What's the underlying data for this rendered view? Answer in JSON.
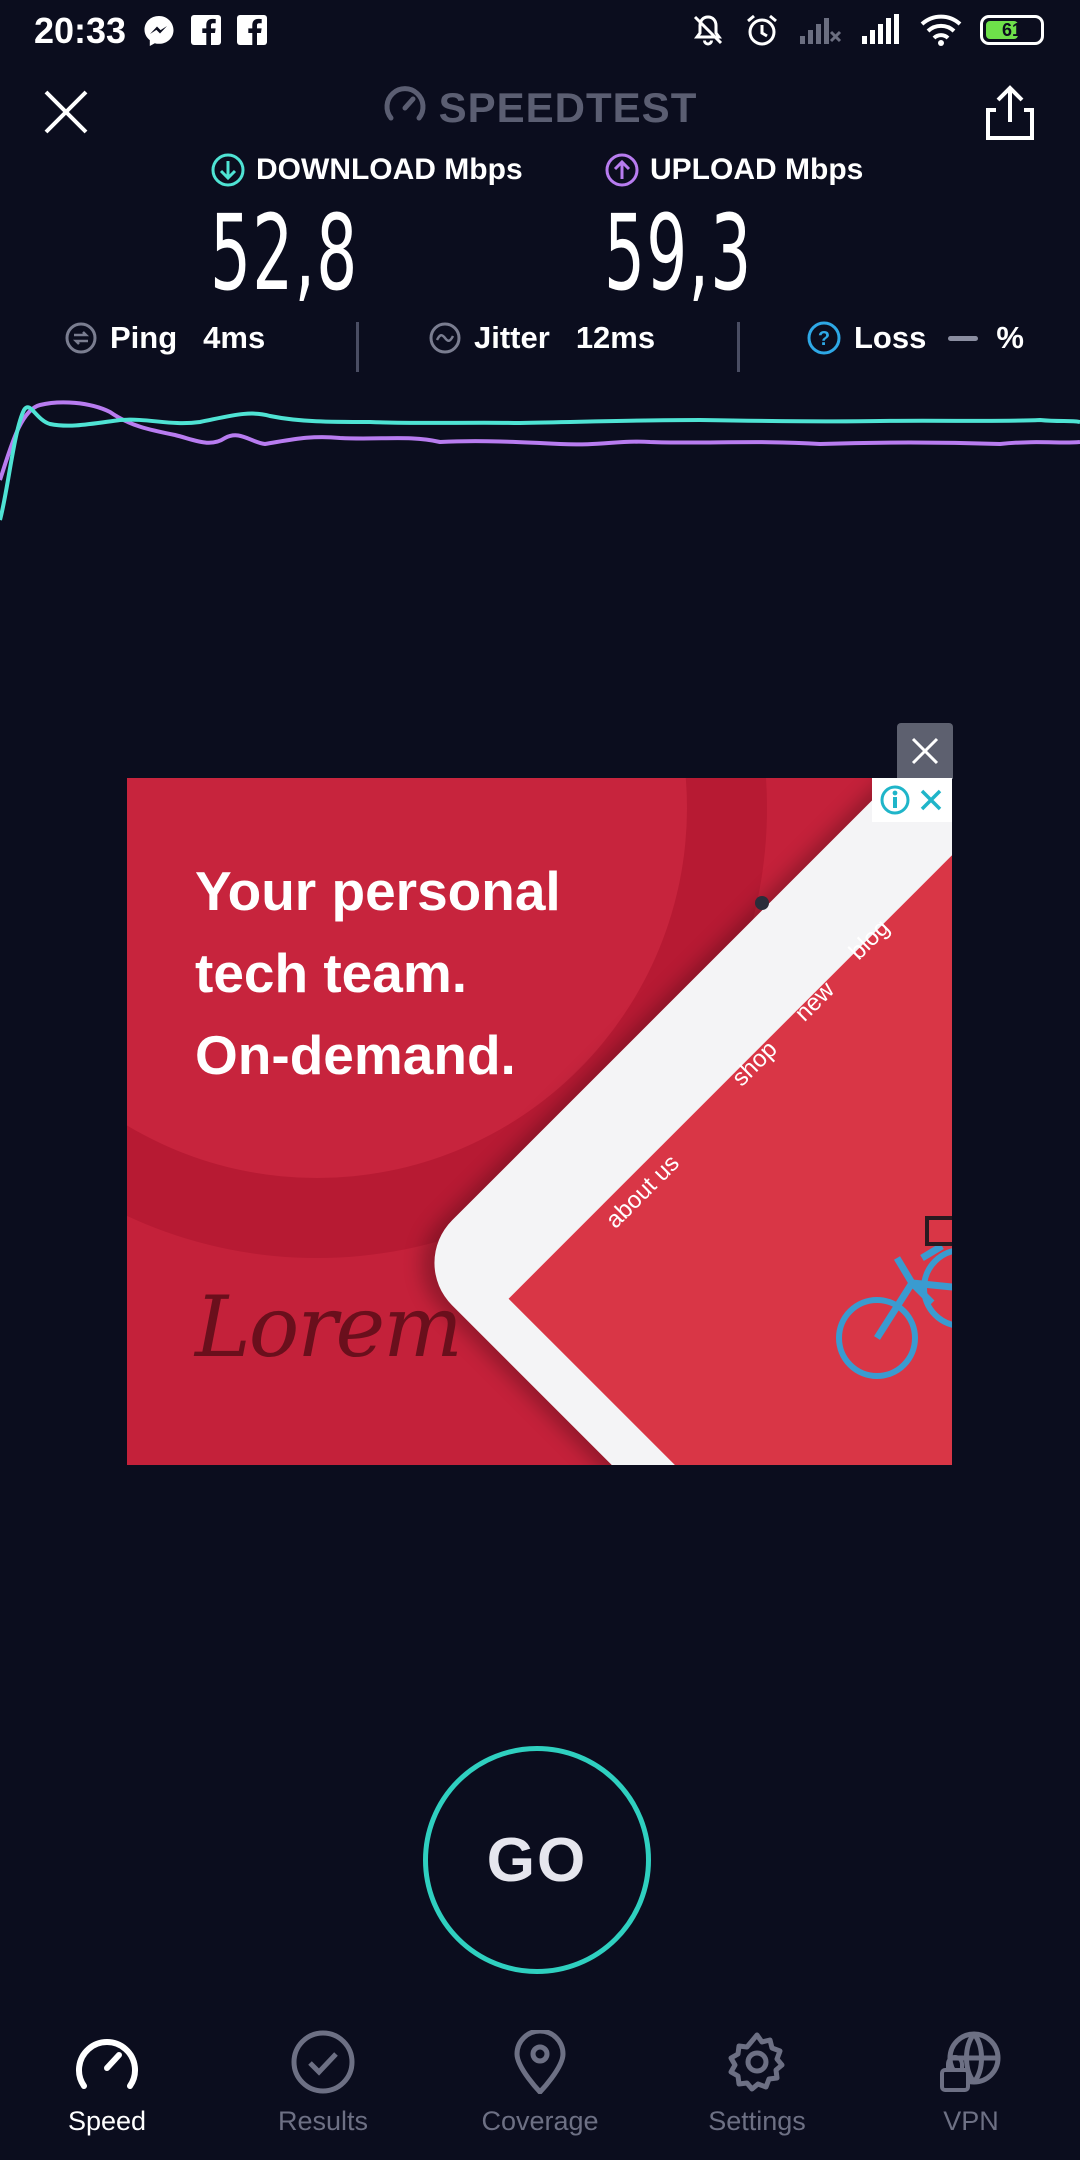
{
  "status_bar": {
    "time": "20:33",
    "battery": "61",
    "battery_level": 0.61,
    "left_icons": [
      "messenger-icon",
      "facebook-icon",
      "facebook-icon"
    ],
    "right_icons": [
      "notifications-off-icon",
      "alarm-icon",
      "signal-off-icon",
      "signal-icon",
      "wifi-icon",
      "battery-icon"
    ]
  },
  "header": {
    "title": "SPEEDTEST",
    "close_icon": "close-icon",
    "share_icon": "share-icon"
  },
  "download": {
    "label": "DOWNLOAD Mbps",
    "value": "52,8",
    "color": "#4fe3d4"
  },
  "upload": {
    "label": "UPLOAD Mbps",
    "value": "59,3",
    "color": "#b87cf0"
  },
  "metrics": {
    "ping": {
      "label": "Ping",
      "value": "4ms"
    },
    "jitter": {
      "label": "Jitter",
      "value": "12ms"
    },
    "loss": {
      "label": "Loss",
      "value": "%"
    }
  },
  "ad": {
    "headline_1": "Your personal",
    "headline_2": "tech team.",
    "headline_3": "On-demand.",
    "logo": "Lorem",
    "nav_about": "about us",
    "nav_shop": "shop",
    "nav_new": "new",
    "nav_blog": "blog"
  },
  "go_button": "GO",
  "bottom_nav": [
    {
      "label": "Speed",
      "icon": "speedometer-icon",
      "active": true
    },
    {
      "label": "Results",
      "icon": "checkmark-circle-icon",
      "active": false
    },
    {
      "label": "Coverage",
      "icon": "map-pin-icon",
      "active": false
    },
    {
      "label": "Settings",
      "icon": "gear-icon",
      "active": false
    },
    {
      "label": "VPN",
      "icon": "vpn-globe-lock-icon",
      "active": false
    }
  ],
  "colors": {
    "background": "#0b0d1e",
    "accent_teal": "#2fd0c0",
    "download_line": "#4fe3d4",
    "upload_line": "#b87cf0",
    "ad_red": "#c4213a"
  }
}
